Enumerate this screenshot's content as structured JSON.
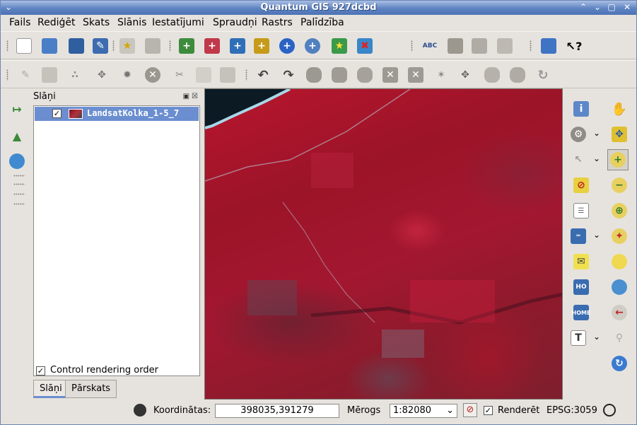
{
  "window": {
    "title": "Quantum GIS 927dcbd"
  },
  "menu": [
    "Fails",
    "Rediģēt",
    "Skats",
    "Slānis",
    "Iestatījumi",
    "Spraudņi",
    "Rastrs",
    "Palīdzība"
  ],
  "toolbar1": [
    "new-project",
    "open-project",
    "save-project",
    "save-as",
    "print-composer",
    "print",
    "add-vector-layer",
    "add-raster-layer",
    "add-postgis-layer",
    "add-spatialite-layer",
    "add-wms-layer",
    "add-wfs-layer",
    "new-vector-layer",
    "remove-layer",
    "labeling",
    "label-tool",
    "plugins",
    "help-book",
    "whats-this"
  ],
  "toolbar2": [
    "toggle-editing",
    "save-edits",
    "add-feature",
    "move-feature",
    "node-tool",
    "delete-selected",
    "cut",
    "copy",
    "paste",
    "undo",
    "redo",
    "simplify",
    "add-ring",
    "add-part",
    "delete-ring",
    "delete-part",
    "reshape",
    "split",
    "merge",
    "merge-attributes",
    "rotate"
  ],
  "layers_panel": {
    "title": "Slāņi",
    "layer_name": "LandsatKolka_1-5_7",
    "layer_checked": true,
    "control_rendering_label": "Control rendering order",
    "tabs": [
      "Slāņi",
      "Pārskats"
    ]
  },
  "statusbar": {
    "coord_label": "Koordinātas:",
    "coord_value": "398035,391279",
    "scale_label": "Mērogs",
    "scale_value": "1:82080",
    "render_label": "Renderēt",
    "crs": "EPSG:3059"
  },
  "colors": {
    "titlebar": "#5e83c2",
    "selection": "#6b8ed0",
    "map_red": "#a31730"
  }
}
